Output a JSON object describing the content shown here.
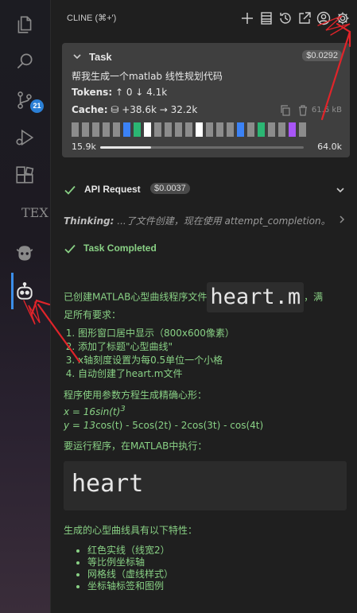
{
  "activity_bar": {
    "scm_badge": "21",
    "tex_label": "TEX"
  },
  "header": {
    "title": "CLINE (⌘+')"
  },
  "task": {
    "title": "Task",
    "cost": "$0.0292",
    "description": "帮我生成一个matlab 线性规划代码",
    "tokens_label": "Tokens:",
    "tokens_up": "↑ 0",
    "tokens_down": "↓ 4.1k",
    "cache_label": "Cache:",
    "cache_write": "+38.6k",
    "cache_read": "→ 32.2k",
    "size": "61.6 kB",
    "context_used": "15.9k",
    "context_max": "64.0k",
    "context_fraction": 0.25,
    "blocks": [
      "#8c8c8c",
      "#8c8c8c",
      "#8c8c8c",
      "#8c8c8c",
      "#8c8c8c",
      "#3b82f6",
      "#2bb673",
      "#ffffff",
      "#8c8c8c",
      "#8c8c8c",
      "#8c8c8c",
      "#8c8c8c",
      "#ffffff",
      "#8c8c8c",
      "#8c8c8c",
      "#8c8c8c",
      "#3b82f6",
      "#8c8c8c",
      "#2bb673",
      "#8c8c8c",
      "#8c8c8c",
      "#a855f7",
      "#8c8c8c"
    ]
  },
  "messages": {
    "api_request_label": "API Request",
    "api_request_cost": "$0.0037",
    "thinking_label": "Thinking:",
    "thinking_text": "...了文件创建，现在使用 attempt_completion。",
    "task_completed_label": "Task Completed",
    "intro_before": "已创建MATLAB心型曲线程序文件",
    "intro_code": "heart.m",
    "intro_after": "，满",
    "intro_line2": "足所有要求：",
    "requirements": [
      "图形窗口居中显示（800x600像素）",
      "添加了标题\"心型曲线\"",
      "x轴刻度设置为每0.5单位一个小格",
      "自动创建了heart.m文件"
    ],
    "param_intro": "程序使用参数方程生成精确心形：",
    "eq_x_prefix": "x = 16",
    "eq_x_func": "sin(t)",
    "eq_x_pow": "3",
    "eq_y_prefix": "y = 13",
    "eq_y_rest": "cos(t) - 5cos(2t) - 2cos(3t) - cos(4t)",
    "run_intro": "要运行程序，在MATLAB中执行：",
    "run_code": "heart",
    "features_intro": "生成的心型曲线具有以下特性：",
    "features": [
      "红色实线（线宽2）",
      "等比例坐标轴",
      "网格线（虚线样式）",
      "坐标轴标签和图例"
    ]
  },
  "colors": {
    "accent_green": "#89d185",
    "active_indicator": "#3b8eea",
    "annotation_red": "#e0242a"
  }
}
